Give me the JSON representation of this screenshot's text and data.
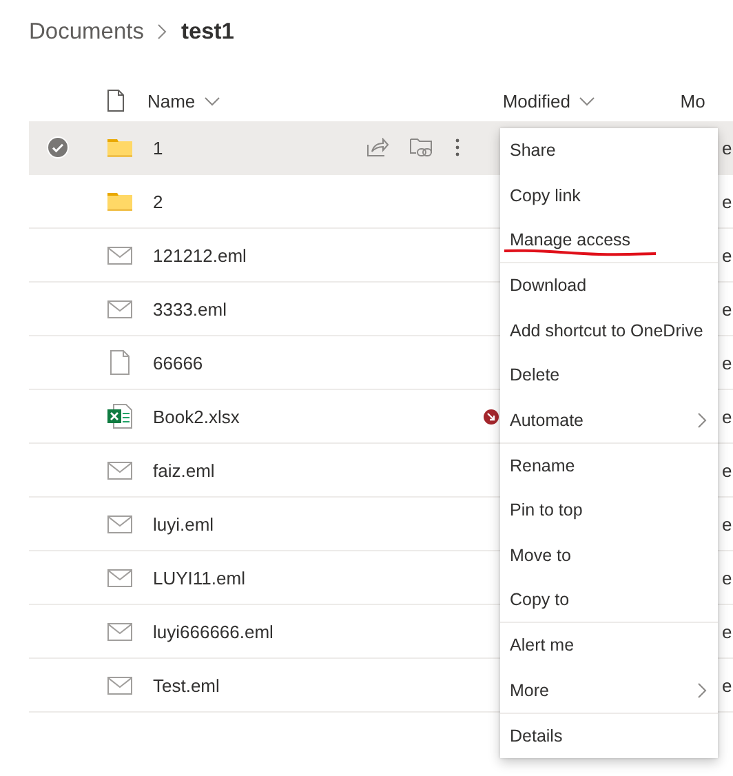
{
  "breadcrumb": [
    {
      "label": "Documents",
      "current": false
    },
    {
      "label": "test1",
      "current": true
    }
  ],
  "columns": [
    {
      "label": "Name",
      "sortable": true
    },
    {
      "label": "Modified",
      "sortable": true
    },
    {
      "label": "Mo",
      "sortable": false
    }
  ],
  "rows": [
    {
      "name": "1",
      "kind": "folder",
      "selected": true,
      "alert": false,
      "column_3": "e"
    },
    {
      "name": "2",
      "kind": "folder",
      "selected": false,
      "alert": false,
      "column_3": "e"
    },
    {
      "name": "121212.eml",
      "kind": "mail",
      "selected": false,
      "alert": false,
      "column_3": "e"
    },
    {
      "name": "3333.eml",
      "kind": "mail",
      "selected": false,
      "alert": false,
      "column_3": "e"
    },
    {
      "name": "66666",
      "kind": "file",
      "selected": false,
      "alert": false,
      "column_3": "e"
    },
    {
      "name": "Book2.xlsx",
      "kind": "excel",
      "selected": false,
      "alert": true,
      "column_3": "e"
    },
    {
      "name": "faiz.eml",
      "kind": "mail",
      "selected": false,
      "alert": false,
      "column_3": "e"
    },
    {
      "name": "luyi.eml",
      "kind": "mail",
      "selected": false,
      "alert": false,
      "column_3": "e"
    },
    {
      "name": "LUYI11.eml",
      "kind": "mail",
      "selected": false,
      "alert": false,
      "column_3": "e"
    },
    {
      "name": "luyi666666.eml",
      "kind": "mail",
      "selected": false,
      "alert": false,
      "column_3": "e"
    },
    {
      "name": "Test.eml",
      "kind": "mail",
      "selected": false,
      "alert": false,
      "column_3": "e"
    }
  ],
  "context_menu": {
    "groups": [
      {
        "items": [
          {
            "label": "Share",
            "submenu": false,
            "underlined": false
          },
          {
            "label": "Copy link",
            "submenu": false,
            "underlined": false
          },
          {
            "label": "Manage access",
            "submenu": false,
            "underlined": true
          }
        ]
      },
      {
        "items": [
          {
            "label": "Download",
            "submenu": false,
            "underlined": false
          },
          {
            "label": "Add shortcut to OneDrive",
            "submenu": false,
            "underlined": false
          },
          {
            "label": "Delete",
            "submenu": false,
            "underlined": false
          },
          {
            "label": "Automate",
            "submenu": true,
            "underlined": false
          }
        ]
      },
      {
        "items": [
          {
            "label": "Rename",
            "submenu": false,
            "underlined": false
          },
          {
            "label": "Pin to top",
            "submenu": false,
            "underlined": false
          },
          {
            "label": "Move to",
            "submenu": false,
            "underlined": false
          },
          {
            "label": "Copy to",
            "submenu": false,
            "underlined": false
          }
        ]
      },
      {
        "items": [
          {
            "label": "Alert me",
            "submenu": false,
            "underlined": false
          },
          {
            "label": "More",
            "submenu": true,
            "underlined": false
          }
        ]
      },
      {
        "items": [
          {
            "label": "Details",
            "submenu": false,
            "underlined": false
          }
        ]
      }
    ]
  }
}
